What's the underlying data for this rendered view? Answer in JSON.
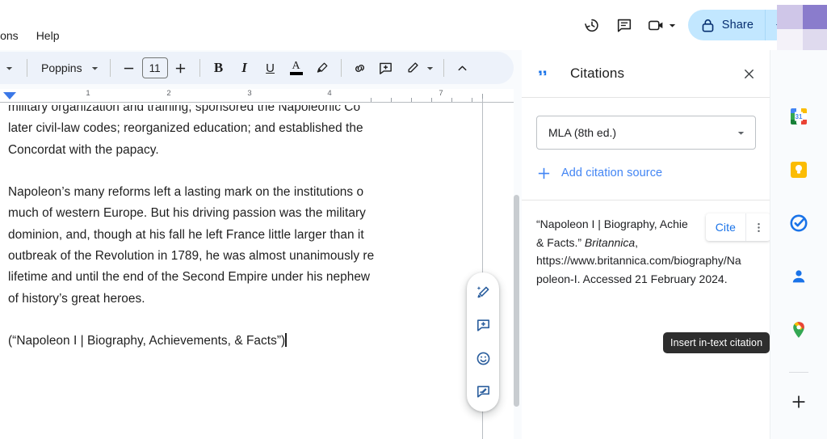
{
  "app": {
    "name": "Google Docs",
    "background": "#f9fbfd"
  },
  "menubar": {
    "items": [
      {
        "label": "Extensions",
        "truncated": "sions"
      },
      {
        "label": "Help"
      }
    ]
  },
  "topbar": {
    "history_icon": "version-history-icon",
    "comment_icon": "comment-history-icon",
    "meet_icon": "video-camera-icon",
    "meet_caret": "chevron-down-icon",
    "share": {
      "label": "Share",
      "lock_icon": "lock-icon",
      "caret_icon": "chevron-down-icon",
      "bg_color": "#c2e7ff",
      "text_color": "#062e6f"
    },
    "gemini_icon": "gemini-spark-icon",
    "avatar": {
      "name": "avatar",
      "colors": [
        "#cfc6e8",
        "#8a7ccc",
        "#f2f0f8",
        "#ddd8ee"
      ]
    }
  },
  "toolbar": {
    "style_label": "t",
    "style_caret": "chevron-down-icon",
    "font_name": "Poppins",
    "font_caret": "chevron-down-icon",
    "decrease_label": "−",
    "font_size": "11",
    "increase_label": "+",
    "bold_label": "B",
    "italic_label": "I",
    "underline_label": "U",
    "text_color_label": "A",
    "text_color_swatch": "#000000",
    "highlight_icon": "highlighter-icon",
    "link_icon": "link-icon",
    "comment_icon": "add-comment-icon",
    "edit_mode_icon": "pencil-icon",
    "edit_mode_caret": "chevron-down-icon",
    "collapse_icon": "chevron-up-icon"
  },
  "ruler": {
    "numbers": [
      "1",
      "2",
      "3",
      "4",
      "7"
    ],
    "indent_marker": "left-indent-marker"
  },
  "document": {
    "paragraphs": [
      "military organization and training; sponsored the Napoleonic Co",
      "later civil-law codes; reorganized education; and established the",
      "Concordat with the papacy."
    ],
    "paragraph2": [
      "Napoleon’s many reforms left a lasting mark on the institutions o",
      "much of western Europe. But his driving passion was the military",
      "dominion, and, though at his fall he left France little larger than it",
      "outbreak of the Revolution in 1789, he was almost unanimously re",
      "lifetime and until the end of the Second Empire under his nephew",
      "of history’s great heroes."
    ],
    "paragraph3": "(“Napoleon I | Biography, Achievements, & Facts”)"
  },
  "float_pill": {
    "items": [
      {
        "name": "magic-pencil-icon"
      },
      {
        "name": "add-comment-icon"
      },
      {
        "name": "emoji-reaction-icon"
      },
      {
        "name": "suggest-edit-icon"
      }
    ]
  },
  "citations_panel": {
    "quote_icon": "quote-icon",
    "title": "Citations",
    "close_icon": "close-icon",
    "style_select": {
      "value": "MLA (8th ed.)",
      "caret_icon": "chevron-down-icon"
    },
    "add_source": {
      "plus_icon": "plus-icon",
      "label": "Add citation source",
      "color": "#4285f4"
    },
    "citation": {
      "part1": "“Napoleon I | Biography, Achie",
      "part2": "& Facts.” ",
      "italic": "Britannica",
      "part3": ",",
      "part4": "https://www.britannica.com/biography/Na",
      "part5": "poleon-I. Accessed 21 February 2024.",
      "cite_button": "Cite",
      "more_icon": "more-vertical-icon"
    },
    "tooltip": "Insert in-text citation"
  },
  "rail": {
    "items": [
      {
        "name": "google-calendar-icon",
        "label": "Calendar",
        "badge": "31"
      },
      {
        "name": "google-keep-icon",
        "label": "Keep"
      },
      {
        "name": "google-tasks-icon",
        "label": "Tasks"
      },
      {
        "name": "google-contacts-icon",
        "label": "Contacts"
      },
      {
        "name": "google-maps-icon",
        "label": "Maps"
      }
    ],
    "add_label": "+"
  }
}
